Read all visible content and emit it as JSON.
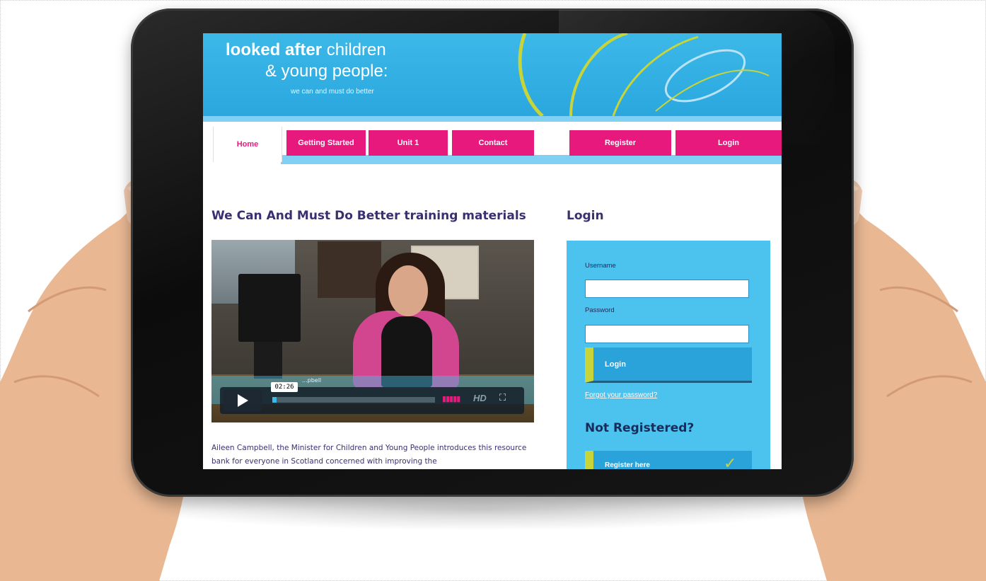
{
  "header": {
    "logo_line1_bold": "looked after",
    "logo_line1_rest": " children",
    "logo_line2": "& young people:",
    "logo_line3": "we can and must do better"
  },
  "nav": {
    "home": "Home",
    "getting_started": "Getting Started",
    "unit1": "Unit 1",
    "contact": "Contact",
    "register": "Register",
    "login": "Login"
  },
  "main": {
    "title": "We Can And Must Do Better training materials",
    "video": {
      "time": "02:26",
      "caption": "...pbell",
      "hd": "HD"
    },
    "intro": "Aileen Campbell, the Minister for Children and Young People introduces this resource bank for everyone in Scotland concerned with improving the"
  },
  "sidebar": {
    "title": "Login",
    "username_label": "Username",
    "password_label": "Password",
    "login_button": "Login",
    "forgot_link": "Forgot your password?",
    "not_registered": "Not Registered?",
    "register_button": "Register here"
  },
  "colors": {
    "brand_blue": "#3cb8e8",
    "brand_pink": "#e8197d",
    "accent_green": "#c7d43a",
    "heading_purple": "#3a2f73"
  }
}
